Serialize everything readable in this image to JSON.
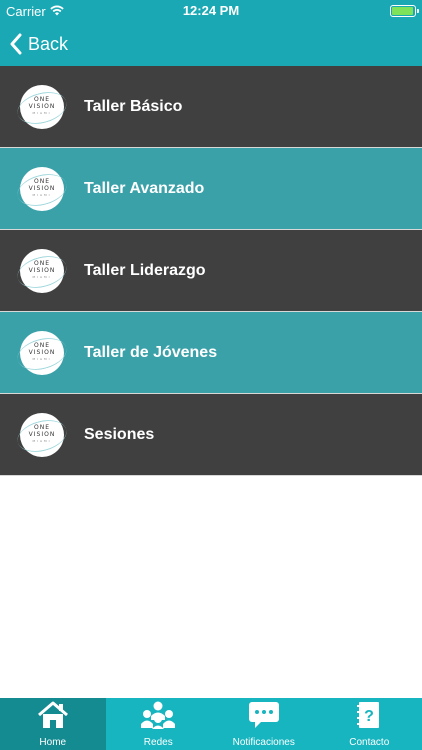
{
  "status_bar": {
    "carrier": "Carrier",
    "time": "12:24 PM",
    "battery_level": 0.95
  },
  "nav_bar": {
    "back_label": "Back"
  },
  "list": {
    "logo_text": {
      "line1": "ONE",
      "line2": "VISION",
      "line3": "MIAMI"
    },
    "items": [
      {
        "label": "Taller Básico",
        "style": "dark"
      },
      {
        "label": "Taller Avanzado",
        "style": "teal"
      },
      {
        "label": "Taller Liderazgo",
        "style": "dark"
      },
      {
        "label": "Taller de Jóvenes",
        "style": "teal"
      },
      {
        "label": "Sesiones",
        "style": "dark"
      }
    ]
  },
  "tab_bar": {
    "tabs": [
      {
        "label": "Home",
        "icon": "home-icon",
        "active": true
      },
      {
        "label": "Redes",
        "icon": "people-icon",
        "active": false
      },
      {
        "label": "Notificaciones",
        "icon": "chat-bubble-icon",
        "active": false
      },
      {
        "label": "Contacto",
        "icon": "contact-book-icon",
        "active": false
      }
    ]
  },
  "colors": {
    "bar": "#1aa9b4",
    "tab_active": "#148a91",
    "row_dark": "#404040",
    "row_teal": "#3aa1a9"
  }
}
